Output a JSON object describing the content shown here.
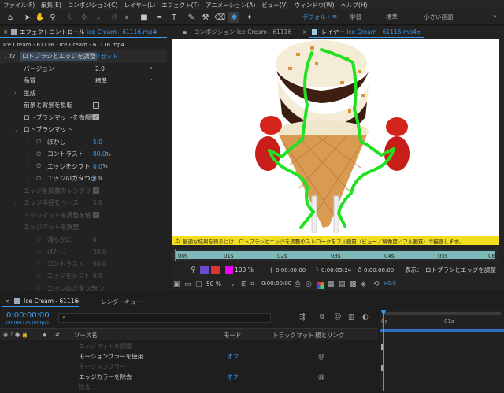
{
  "menu": [
    "ファイル(F)",
    "編集(E)",
    "コンポジション(C)",
    "レイヤー(L)",
    "エフェクト(T)",
    "アニメーション(A)",
    "ビュー(V)",
    "ウィンドウ(W)",
    "ヘルプ(H)"
  ],
  "workspaces": {
    "default": "デフォルト",
    "learn": "学習",
    "standard": "標準",
    "small": "小さい画面"
  },
  "effect_panel": {
    "tab": "エフェクトコントロール",
    "tab_file": "Ice Cream - 61116.mp4",
    "breadcrumb": "Ice Cream - 61116 · Ice Cream - 61116.mp4",
    "fx_label": "fx",
    "effect_name": "ロトブラシとエッジを調整",
    "reset": "リセット",
    "version_label": "バージョン",
    "version_value": "2.0",
    "quality_label": "品質",
    "quality_value": "標準",
    "generate": "生成",
    "invert_fg_bg": "前景と背景を反転",
    "use_roto_matte": "ロトブラシマットを微調整",
    "roto_matte": "ロトブラシマット",
    "blur_label": "ぼかし",
    "blur_value": "5.0",
    "contrast_label": "コントラスト",
    "contrast_value": "80.0",
    "contrast_unit": "%",
    "shift_edge_label": "エッジをシフト",
    "shift_edge_value": "0.0",
    "shift_edge_unit": "%",
    "edge_jitter_label": "エッジのガタつき",
    "edge_jitter_value": "0",
    "edge_jitter_unit": "%",
    "render_refine": "エッジを調整のレンダリ",
    "base_refine": "エッジ半径をベース",
    "base_refine_value": "5.0",
    "refine_mat": "エッジマットを調整を使",
    "refine_edge_matte": "エッジマットを調整",
    "r_smooth": "滑らかに",
    "r_smooth_value": "0",
    "r_blur": "ぼかし",
    "r_blur_value": "50.0",
    "r_contrast": "コントラスト",
    "r_contrast_value": "50.0",
    "r_shift": "エッジをシフト",
    "r_shift_value": "0.0",
    "r_jitter": "エッジのガタつき",
    "r_jitter_value": "オフ"
  },
  "viewer": {
    "comp_tab": "コンポジション",
    "comp_name": "Ice Cream - 61116",
    "layer_tab": "レイヤー",
    "layer_name": "Ice Cream - 61116.mp4",
    "warning": "最適な結果を得るには、ロトブラシとエッジを調整のストロークをフル画質（ビュー／解像度／フル画質）で描画します。",
    "ruler_ticks": [
      "00s",
      "01s",
      "02s",
      "03s",
      "04s",
      "05s",
      "06s"
    ],
    "zoom": "100 %",
    "time_start": "0:00:00:00",
    "time_current": "0:00:05:24",
    "time_duration": "0:00:06:00",
    "display_label": "表示：",
    "display_value": "ロトブラシとエッジを調整",
    "magnify": "50 %",
    "time2": "0:00:00:00",
    "exposure": "+0.0"
  },
  "timeline": {
    "tab": "Ice Cream - 61116",
    "render_queue": "レンダーキュー",
    "timecode": "0:00:00:00",
    "fps": "00000 (25.00 fps)",
    "search_placeholder": "",
    "col_source": "ソース名",
    "col_mode": "モード",
    "col_trackmatte": "トラックマット",
    "col_parent": "親とリンク",
    "rows": [
      {
        "label": "エッジマットを調整",
        "dim": true
      },
      {
        "label": "モーションブラーを使用",
        "value": "オフ",
        "dim": false
      },
      {
        "label": "モーションブラー",
        "dim": true
      },
      {
        "label": "エッジカラーを除去",
        "value": "オフ",
        "dim": false
      },
      {
        "label": "除去",
        "dim": true
      }
    ],
    "ruler_ticks": [
      "0s",
      "01s"
    ]
  },
  "colors": {
    "accent": "#3b9bf0",
    "warning": "#f2dd1e",
    "overlay": "#22e022",
    "ruler": "#7fb8b8"
  }
}
